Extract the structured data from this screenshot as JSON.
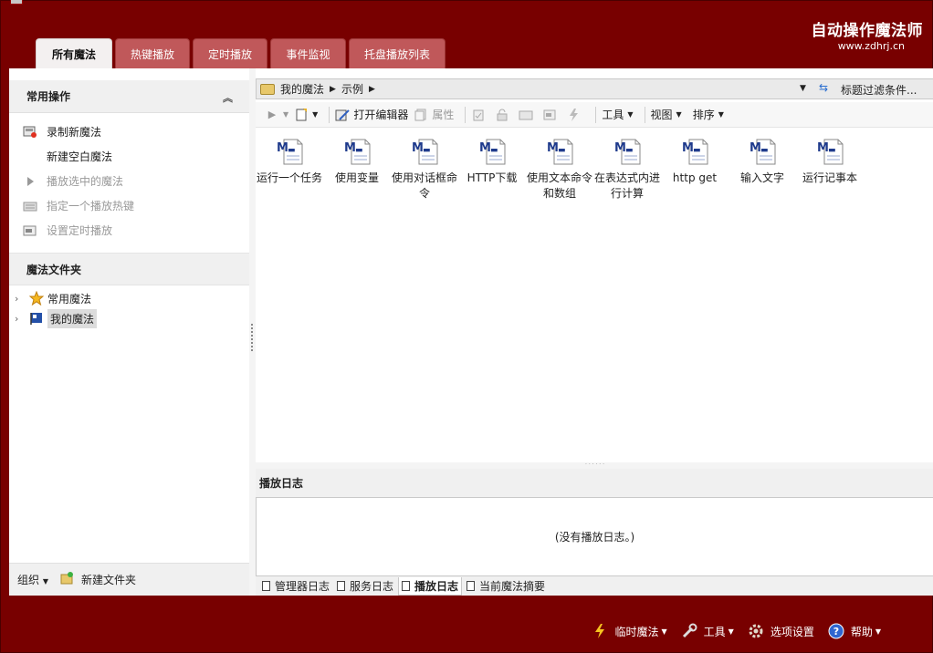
{
  "brand": {
    "title": "自动操作魔法师",
    "url": "www.zdhrj.cn"
  },
  "tabs": [
    {
      "label": "所有魔法",
      "active": true
    },
    {
      "label": "热键播放",
      "active": false
    },
    {
      "label": "定时播放",
      "active": false
    },
    {
      "label": "事件监视",
      "active": false
    },
    {
      "label": "托盘播放列表",
      "active": false
    }
  ],
  "sidebar": {
    "common_ops_title": "常用操作",
    "ops": [
      {
        "label": "录制新魔法",
        "enabled": true,
        "icon": "record-icon"
      },
      {
        "label": "新建空白魔法",
        "enabled": true,
        "icon": ""
      },
      {
        "label": "播放选中的魔法",
        "enabled": false,
        "icon": "play-icon"
      },
      {
        "label": "指定一个播放热键",
        "enabled": false,
        "icon": "keyboard-icon"
      },
      {
        "label": "设置定时播放",
        "enabled": false,
        "icon": "timer-icon"
      }
    ],
    "folders_title": "魔法文件夹",
    "folders": [
      {
        "label": "常用魔法",
        "icon": "star-icon",
        "selected": false
      },
      {
        "label": "我的魔法",
        "icon": "flag-icon",
        "selected": true
      }
    ],
    "footer": {
      "organize": "组织",
      "new_folder": "新建文件夹"
    }
  },
  "address": {
    "crumbs": [
      "我的魔法",
      "示例"
    ],
    "filter": "标题过滤条件..."
  },
  "toolbar": {
    "open_editor": "打开编辑器",
    "properties": "属性",
    "tools": "工具",
    "view": "视图",
    "sort": "排序"
  },
  "files": [
    {
      "label": "运行一个任务"
    },
    {
      "label": "使用变量"
    },
    {
      "label": "使用对话框命令"
    },
    {
      "label": "HTTP下载"
    },
    {
      "label": "使用文本命令和数组"
    },
    {
      "label": "在表达式内进行计算"
    },
    {
      "label": "http get"
    },
    {
      "label": "输入文字"
    },
    {
      "label": "运行记事本"
    }
  ],
  "log": {
    "title": "播放日志",
    "empty": "(没有播放日志。)",
    "tabs": [
      {
        "label": "管理器日志",
        "active": false
      },
      {
        "label": "服务日志",
        "active": false
      },
      {
        "label": "播放日志",
        "active": true
      },
      {
        "label": "当前魔法摘要",
        "active": false
      }
    ]
  },
  "status": {
    "temp_magic": "临时魔法",
    "tools": "工具",
    "options": "选项设置",
    "help": "帮助"
  },
  "colors": {
    "accent": "#780000",
    "tab_inactive": "#c0585a",
    "file_icon_blue": "#1f3b8c"
  }
}
